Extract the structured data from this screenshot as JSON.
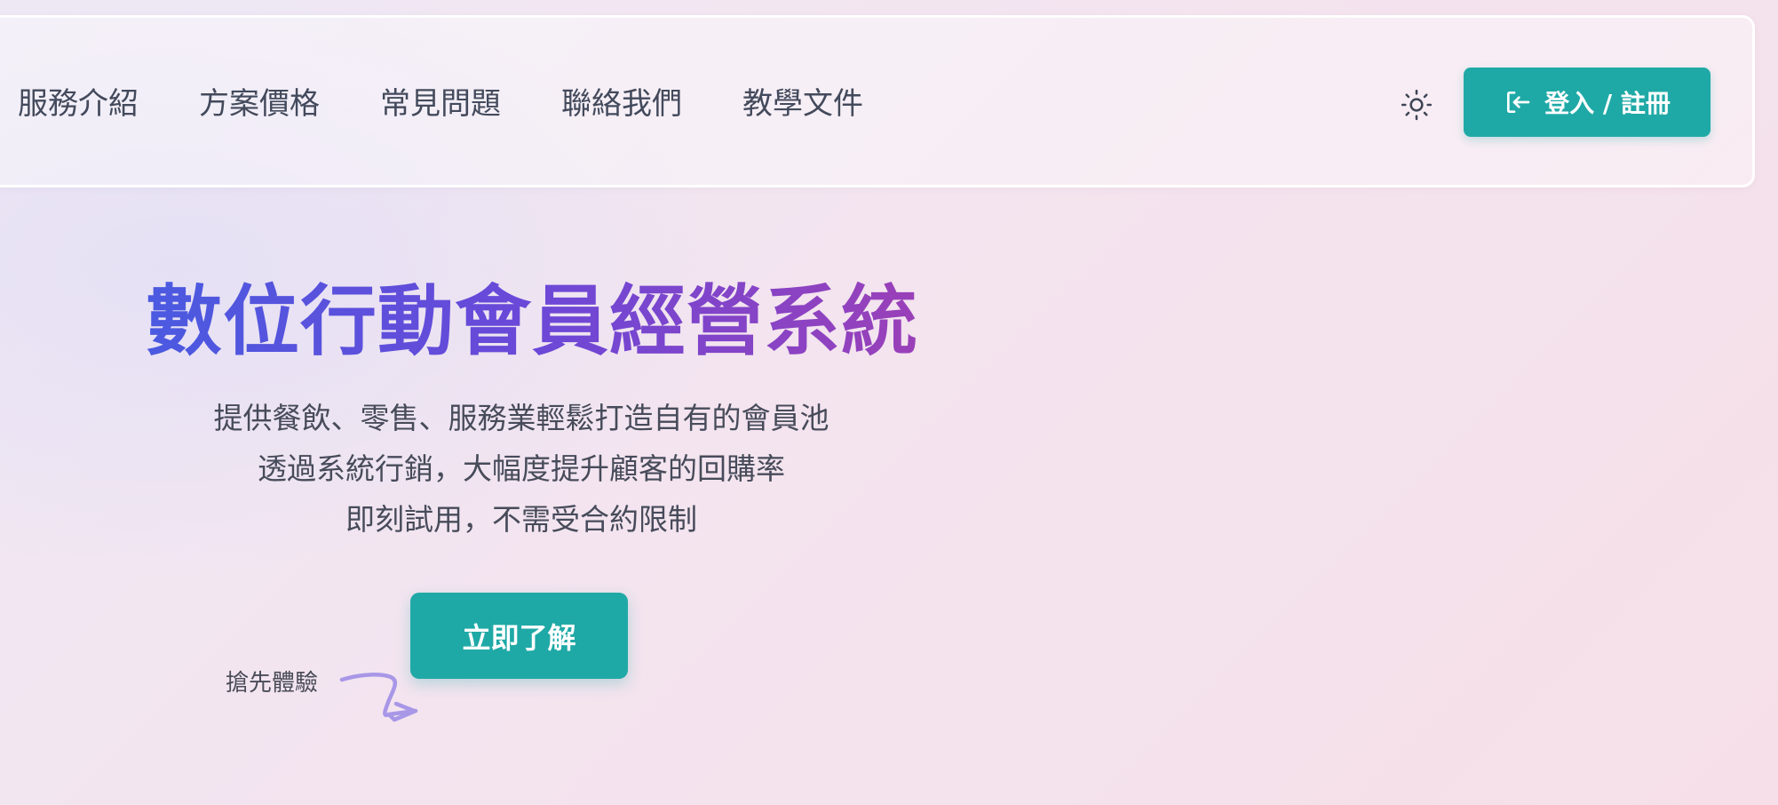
{
  "nav": {
    "items": [
      {
        "label": "服務介紹"
      },
      {
        "label": "方案價格"
      },
      {
        "label": "常見問題"
      },
      {
        "label": "聯絡我們"
      },
      {
        "label": "教學文件"
      }
    ],
    "theme_icon": "sun-icon",
    "login_icon": "login-icon",
    "login_label": "登入 / 註冊"
  },
  "hero": {
    "title": "數位行動會員經營系統",
    "lines": [
      "提供餐飲、零售、服務業輕鬆打造自有的會員池",
      "透過系統行銷，大幅度提升顧客的回購率",
      "即刻試用，不需受合約限制"
    ],
    "cta_label": "立即了解",
    "cta_hint": "搶先體驗",
    "hint_icon": "arrow-doodle-icon"
  },
  "colors": {
    "accent": "#1fa9a6",
    "title_gradient_start": "#4a5ae0",
    "title_gradient_end": "#9a40b8",
    "doodle": "#9b8ae6"
  }
}
